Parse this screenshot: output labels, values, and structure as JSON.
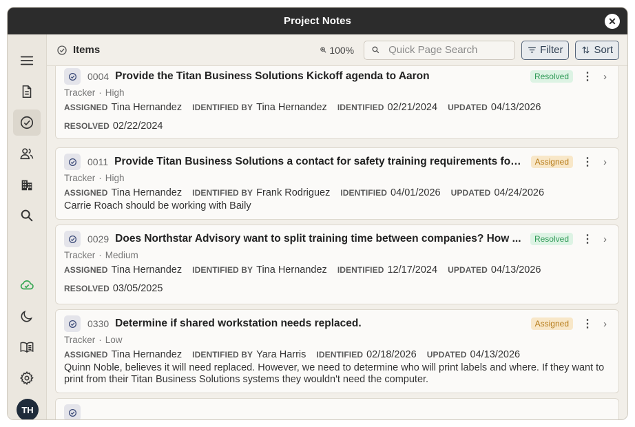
{
  "window": {
    "title": "Project Notes",
    "close_glyph": "✕"
  },
  "sidebar": {
    "items": [
      {
        "name": "menu-icon"
      },
      {
        "name": "document-icon"
      },
      {
        "name": "check-circle-icon",
        "active": true
      },
      {
        "name": "people-icon"
      },
      {
        "name": "building-icon"
      },
      {
        "name": "search-icon"
      },
      {
        "name": "cloud-sync-icon"
      },
      {
        "name": "moon-icon"
      },
      {
        "name": "book-icon"
      },
      {
        "name": "gear-icon"
      }
    ],
    "avatar_initials": "TH"
  },
  "toolbar": {
    "section_label": "Items",
    "zoom": "100%",
    "search_placeholder": "Quick Page Search",
    "filter_label": "Filter",
    "sort_label": "Sort"
  },
  "labels": {
    "assigned": "ASSIGNED",
    "identified_by": "IDENTIFIED BY",
    "identified": "IDENTIFIED",
    "updated": "UPDATED",
    "resolved": "RESOLVED"
  },
  "items": [
    {
      "number": "0004",
      "title": "Provide the Titan Business Solutions Kickoff agenda to Aaron",
      "status": "Resolved",
      "category": "Tracker",
      "priority": "High",
      "assigned": "Tina Hernandez",
      "identified_by": "Tina Hernandez",
      "identified": "02/21/2024",
      "updated": "04/13/2026",
      "resolved": "02/22/2024",
      "notes": ""
    },
    {
      "number": "0011",
      "title": "Provide Titan Business Solutions a contact for safety training requirements for ...",
      "status": "Assigned",
      "category": "Tracker",
      "priority": "High",
      "assigned": "Tina Hernandez",
      "identified_by": "Frank Rodriguez",
      "identified": "04/01/2026",
      "updated": "04/24/2026",
      "resolved": "",
      "notes": "Carrie Roach should be working with Baily"
    },
    {
      "number": "0029",
      "title": "Does Northstar Advisory want to split training time between companies? How ...",
      "status": "Resolved",
      "category": "Tracker",
      "priority": "Medium",
      "assigned": "Tina Hernandez",
      "identified_by": "Tina Hernandez",
      "identified": "12/17/2024",
      "updated": "04/13/2026",
      "resolved": "03/05/2025",
      "notes": ""
    },
    {
      "number": "0330",
      "title": "Determine if shared workstation needs replaced.",
      "status": "Assigned",
      "category": "Tracker",
      "priority": "Low",
      "assigned": "Tina Hernandez",
      "identified_by": "Yara Harris",
      "identified": "02/18/2026",
      "updated": "04/13/2026",
      "resolved": "",
      "notes": "Quinn Noble, believes it will need replaced. However, we need to determine who will print labels and where. If they want to print from their Titan Business Solutions systems they wouldn't need the computer."
    }
  ],
  "colors": {
    "resolved": "#2f9a56",
    "assigned": "#b57a17",
    "active_nav": "#dcd7cd",
    "titlebar": "#2c2c2c",
    "cloud": "#3aa856"
  }
}
